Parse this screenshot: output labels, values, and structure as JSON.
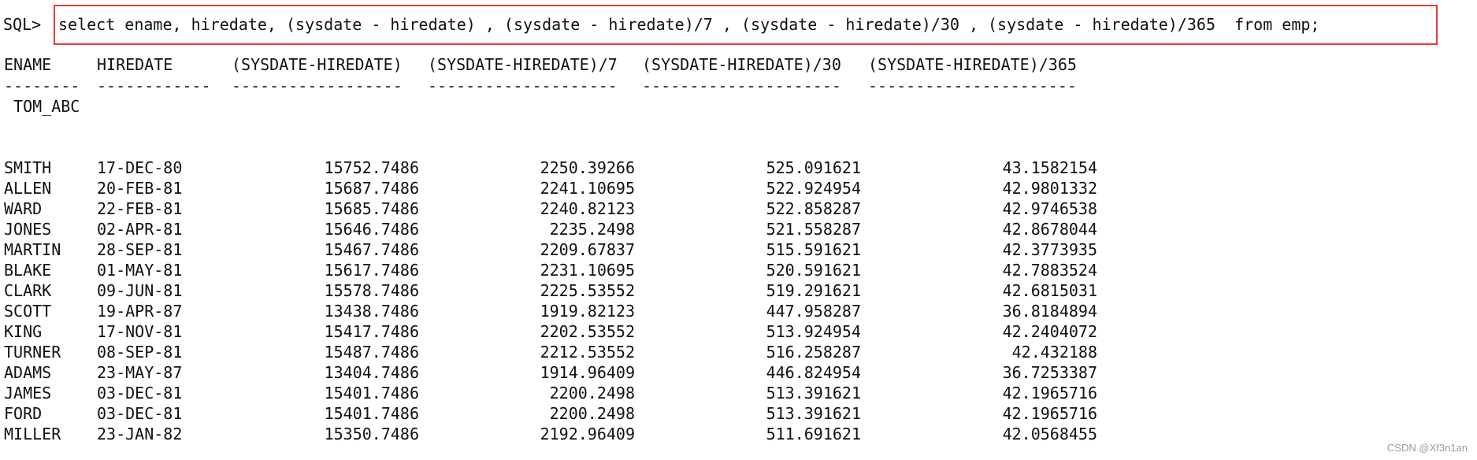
{
  "terminal": {
    "prompt": "SQL>",
    "command": "select ename, hiredate, (sysdate - hiredate) , (sysdate - hiredate)/7 , (sysdate - hiredate)/30 , (sysdate - hiredate)/365  from emp;",
    "highlight_color": "#e23b3b"
  },
  "table": {
    "columns": [
      "ENAME",
      "HIREDATE",
      "(SYSDATE-HIREDATE)",
      "(SYSDATE-HIREDATE)/7",
      "(SYSDATE-HIREDATE)/30",
      "(SYSDATE-HIREDATE)/365"
    ],
    "separators": [
      "--------",
      "------------",
      "------------------",
      "--------------------",
      "---------------------",
      "----------------------"
    ],
    "first_row_value": " TOM_ABC",
    "rows": [
      {
        "ename": "SMITH",
        "hiredate": "17-DEC-80",
        "days": "15752.7486",
        "weeks": "2250.39266",
        "months": "525.091621",
        "years": "43.1582154"
      },
      {
        "ename": "ALLEN",
        "hiredate": "20-FEB-81",
        "days": "15687.7486",
        "weeks": "2241.10695",
        "months": "522.924954",
        "years": "42.9801332"
      },
      {
        "ename": "WARD",
        "hiredate": "22-FEB-81",
        "days": "15685.7486",
        "weeks": "2240.82123",
        "months": "522.858287",
        "years": "42.9746538"
      },
      {
        "ename": "JONES",
        "hiredate": "02-APR-81",
        "days": "15646.7486",
        "weeks": "2235.2498",
        "months": "521.558287",
        "years": "42.8678044"
      },
      {
        "ename": "MARTIN",
        "hiredate": "28-SEP-81",
        "days": "15467.7486",
        "weeks": "2209.67837",
        "months": "515.591621",
        "years": "42.3773935"
      },
      {
        "ename": "BLAKE",
        "hiredate": "01-MAY-81",
        "days": "15617.7486",
        "weeks": "2231.10695",
        "months": "520.591621",
        "years": "42.7883524"
      },
      {
        "ename": "CLARK",
        "hiredate": "09-JUN-81",
        "days": "15578.7486",
        "weeks": "2225.53552",
        "months": "519.291621",
        "years": "42.6815031"
      },
      {
        "ename": "SCOTT",
        "hiredate": "19-APR-87",
        "days": "13438.7486",
        "weeks": "1919.82123",
        "months": "447.958287",
        "years": "36.8184894"
      },
      {
        "ename": "KING",
        "hiredate": "17-NOV-81",
        "days": "15417.7486",
        "weeks": "2202.53552",
        "months": "513.924954",
        "years": "42.2404072"
      },
      {
        "ename": "TURNER",
        "hiredate": "08-SEP-81",
        "days": "15487.7486",
        "weeks": "2212.53552",
        "months": "516.258287",
        "years": "42.432188"
      },
      {
        "ename": "ADAMS",
        "hiredate": "23-MAY-87",
        "days": "13404.7486",
        "weeks": "1914.96409",
        "months": "446.824954",
        "years": "36.7253387"
      },
      {
        "ename": "JAMES",
        "hiredate": "03-DEC-81",
        "days": "15401.7486",
        "weeks": "2200.2498",
        "months": "513.391621",
        "years": "42.1965716"
      },
      {
        "ename": "FORD",
        "hiredate": "03-DEC-81",
        "days": "15401.7486",
        "weeks": "2200.2498",
        "months": "513.391621",
        "years": "42.1965716"
      },
      {
        "ename": "MILLER",
        "hiredate": "23-JAN-82",
        "days": "15350.7486",
        "weeks": "2192.96409",
        "months": "511.691621",
        "years": "42.0568455"
      }
    ]
  },
  "watermark": "CSDN @Xf3n1an"
}
